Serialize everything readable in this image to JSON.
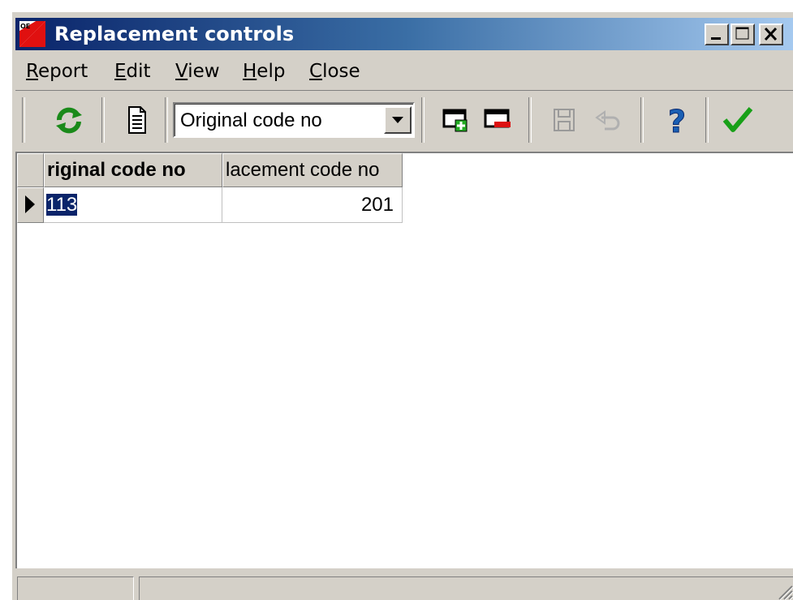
{
  "window": {
    "title": "Replacement controls",
    "icon_text": "OE"
  },
  "menu": {
    "items": [
      {
        "label": "Report",
        "accel": "R",
        "rest": "eport"
      },
      {
        "label": "Edit",
        "accel": "E",
        "rest": "dit"
      },
      {
        "label": "View",
        "accel": "V",
        "rest": "iew"
      },
      {
        "label": "Help",
        "accel": "H",
        "rest": "elp"
      },
      {
        "label": "Close",
        "accel": "C",
        "rest": "lose"
      }
    ]
  },
  "toolbar": {
    "refresh_icon": "refresh-icon",
    "report_icon": "document-icon",
    "search_field": "Original code no",
    "add_icon": "add-record-icon",
    "delete_icon": "delete-record-icon",
    "save_icon": "save-icon",
    "undo_icon": "undo-icon",
    "help_icon": "help-icon",
    "ok_icon": "checkmark-icon"
  },
  "grid": {
    "columns": [
      "riginal code no",
      "lacement code no"
    ],
    "rows": [
      {
        "original": "113",
        "replacement": "201"
      }
    ]
  },
  "colors": {
    "title_start": "#0a246a",
    "title_end": "#a6caf0",
    "selection": "#0a246a",
    "face": "#d4d0c8"
  }
}
